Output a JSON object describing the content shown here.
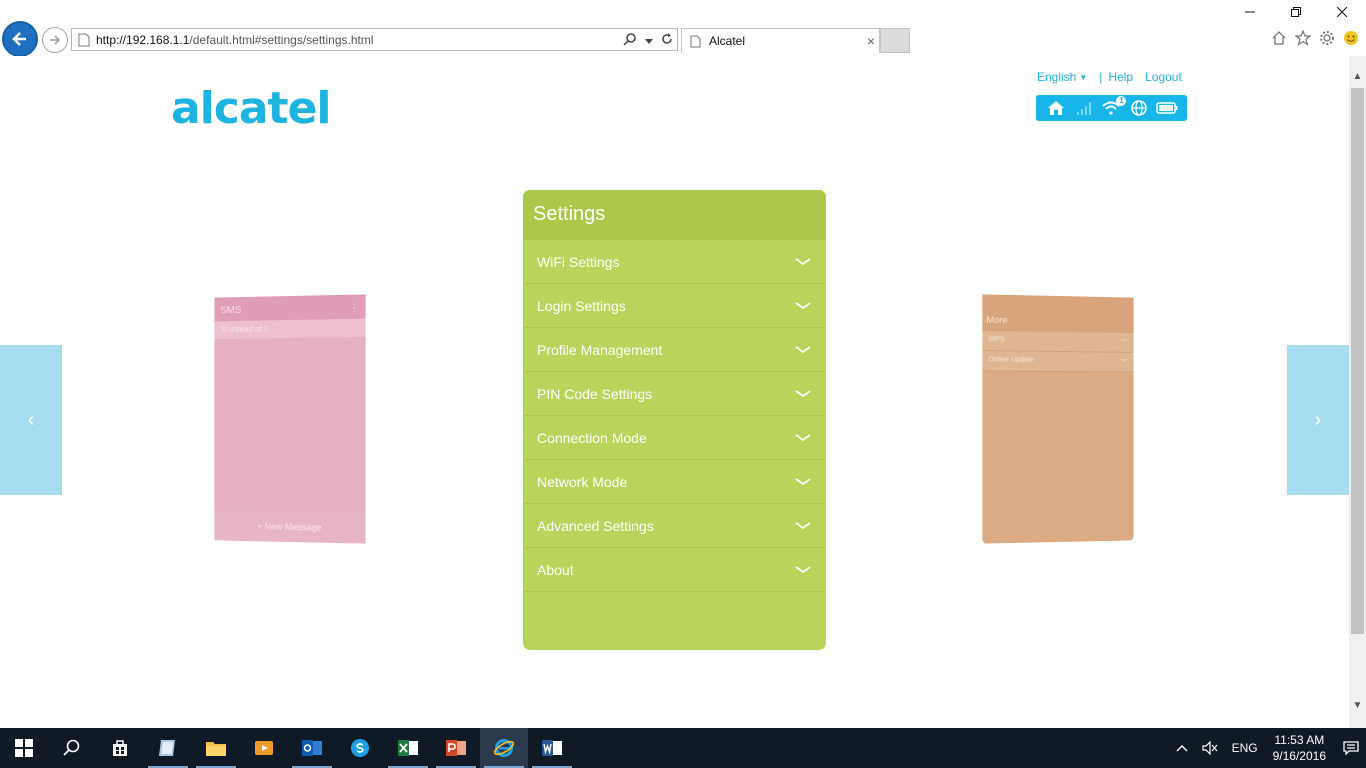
{
  "browser": {
    "url_host": "http://192.168.1.1",
    "url_rest": "/default.html#settings/settings.html",
    "tab_title": "Alcatel",
    "tab_close": "×"
  },
  "header": {
    "logo": "alcatel",
    "language": "English",
    "help": "Help",
    "logout": "Logout",
    "wifi_badge": "1"
  },
  "sms_card": {
    "title": "SMS",
    "subtitle": "0 unread of 0",
    "footer": "+ New Message"
  },
  "more_card": {
    "title": "More",
    "items": [
      "WPS",
      "Online Update"
    ]
  },
  "settings": {
    "title": "Settings",
    "items": [
      "WiFi Settings",
      "Login Settings",
      "Profile Management",
      "PIN Code Settings",
      "Connection Mode",
      "Network Mode",
      "Advanced Settings",
      "About"
    ]
  },
  "nav": {
    "left": "‹",
    "right": "›"
  },
  "taskbar": {
    "lang": "ENG",
    "time": "11:53 AM",
    "date": "9/16/2016"
  },
  "colors": {
    "accent": "#1eb3e0",
    "panel": "#b8d55b",
    "panel_header": "#aac94a",
    "sms": "#e6afc4",
    "more": "#dcab83",
    "nav_arrow": "#a5dcef"
  }
}
